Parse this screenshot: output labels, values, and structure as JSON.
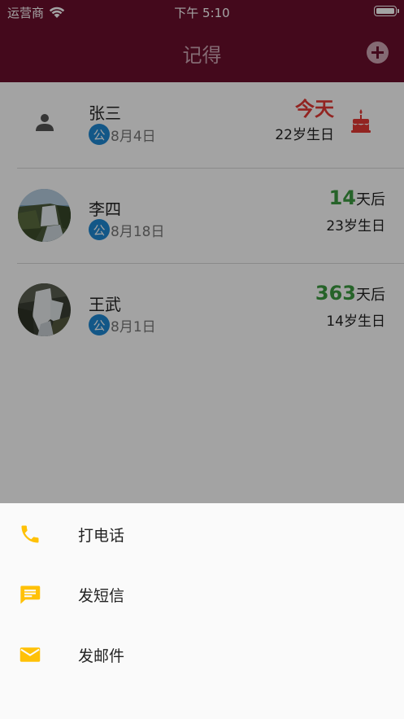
{
  "status_bar": {
    "carrier": "运营商",
    "time": "下午 5:10"
  },
  "app_bar": {
    "title": "记得"
  },
  "contacts": [
    {
      "name": "张三",
      "date_badge": "公",
      "date": "8月4日",
      "today_label": "今天",
      "age_text": "22岁生日",
      "is_today": true
    },
    {
      "name": "李四",
      "date_badge": "公",
      "date": "8月18日",
      "days": "14",
      "days_unit": "天后",
      "age_text": "23岁生日",
      "is_today": false
    },
    {
      "name": "王武",
      "date_badge": "公",
      "date": "8月1日",
      "days": "363",
      "days_unit": "天后",
      "age_text": "14岁生日",
      "is_today": false
    }
  ],
  "action_sheet": {
    "items": [
      {
        "label": "打电话",
        "icon": "phone-icon"
      },
      {
        "label": "发短信",
        "icon": "message-icon"
      },
      {
        "label": "发邮件",
        "icon": "email-icon"
      }
    ]
  },
  "colors": {
    "app_bar": "#6b0f2d",
    "app_bar_text": "#cfa7b4",
    "today": "#e53935",
    "days_count": "#3c9c41",
    "badge": "#1e88d4",
    "sheet_icon": "#ffc107"
  }
}
